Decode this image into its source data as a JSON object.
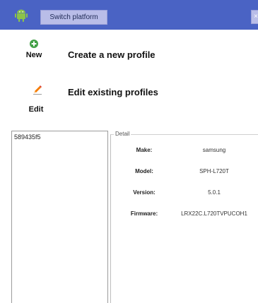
{
  "header": {
    "switch_platform_label": "Switch platform",
    "close_label": "×"
  },
  "actions": {
    "new": {
      "label": "New",
      "title": "Create a new profile"
    },
    "edit": {
      "label": "Edit",
      "title": "Edit existing profiles"
    }
  },
  "device_list": {
    "items": [
      "589435f5"
    ]
  },
  "detail": {
    "legend": "Detail",
    "rows": [
      {
        "label": "Make:",
        "value": "samsung"
      },
      {
        "label": "Model:",
        "value": "SPH-L720T"
      },
      {
        "label": "Version:",
        "value": "5.0.1"
      },
      {
        "label": "Firmware:",
        "value": "LRX22C.L720TVPUCOH1"
      }
    ]
  },
  "colors": {
    "topbar": "#4a63c4",
    "button": "#b9bde8",
    "android": "#8bc34a",
    "new_icon": "#43a047",
    "edit_icon": "#f57c00"
  },
  "icons": {
    "platform": "android-icon",
    "new": "plus-circle-icon",
    "edit": "pencil-icon"
  }
}
